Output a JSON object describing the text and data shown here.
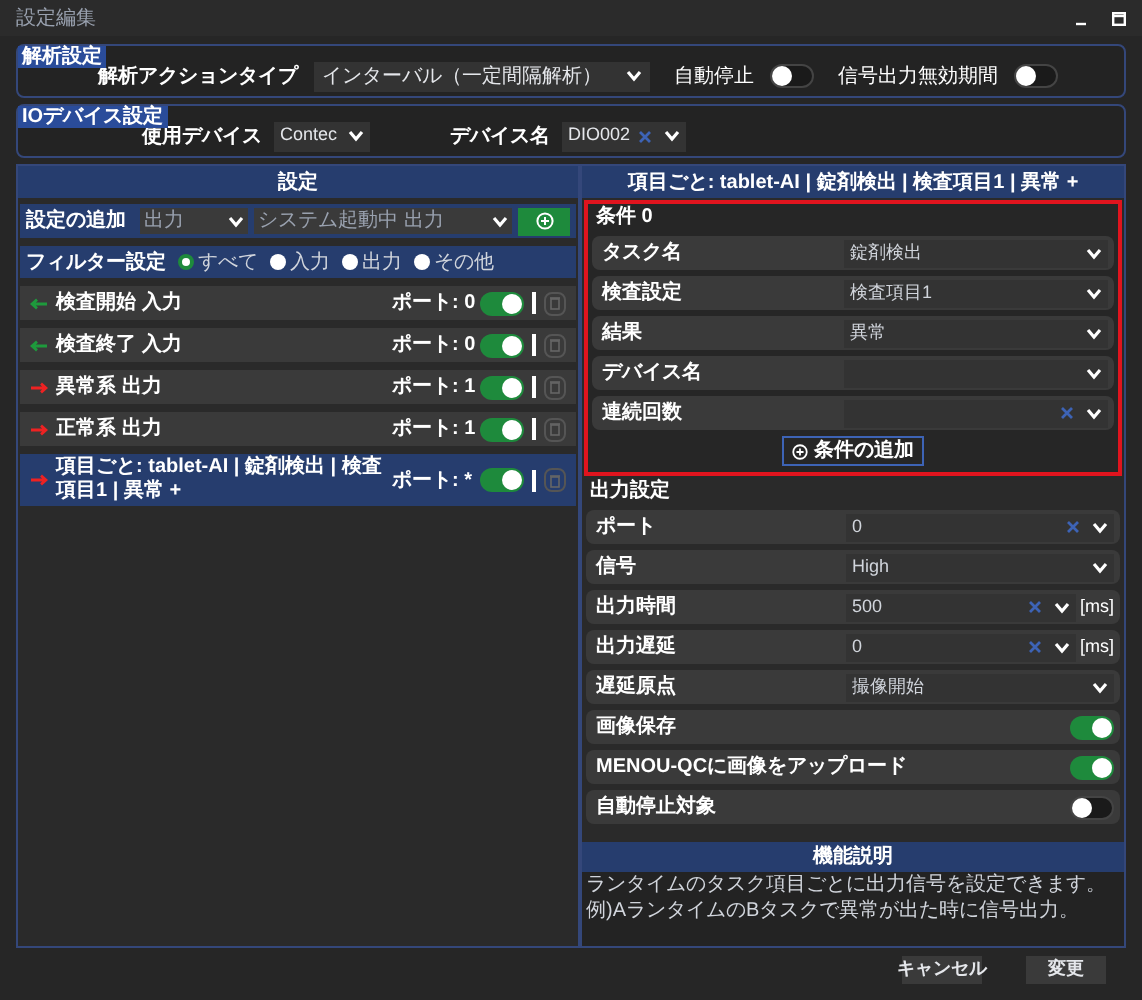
{
  "window": {
    "title": "設定編集"
  },
  "analysis": {
    "section": "解析設定",
    "action_label": "解析アクションタイプ",
    "action_value": "インターバル（一定間隔解析）",
    "toggles": [
      {
        "label": "自動停止",
        "on": false
      },
      {
        "label": "信号出力無効期間",
        "on": false
      }
    ]
  },
  "io_device": {
    "section": "IOデバイス設定",
    "device_label": "使用デバイス",
    "device_value": "Contec",
    "name_label": "デバイス名",
    "name_value": "DIO002",
    "name_clearable": true
  },
  "settings": {
    "title": "設定",
    "add": {
      "label": "設定の追加",
      "type_value": "出力",
      "item_value": "システム起動中 出力"
    },
    "filter": {
      "label": "フィルター設定",
      "options": [
        {
          "label": "すべて",
          "selected": true
        },
        {
          "label": "入力",
          "selected": false
        },
        {
          "label": "出力",
          "selected": false
        },
        {
          "label": "その他",
          "selected": false
        }
      ]
    },
    "items": [
      {
        "kind": "input",
        "label": "検査開始 入力",
        "port": "ポート: 0",
        "enabled": true,
        "selected": false
      },
      {
        "kind": "input",
        "label": "検査終了 入力",
        "port": "ポート: 0",
        "enabled": true,
        "selected": false
      },
      {
        "kind": "output",
        "label": "異常系 出力",
        "port": "ポート: 1",
        "enabled": true,
        "selected": false
      },
      {
        "kind": "output",
        "label": "正常系 出力",
        "port": "ポート: 1",
        "enabled": true,
        "selected": false
      },
      {
        "kind": "output",
        "label": "項目ごと: tablet-AI | 錠剤検出 | 検査項目1 | 異常 +",
        "port": "ポート: *",
        "enabled": true,
        "selected": true
      }
    ]
  },
  "detail": {
    "title": "項目ごと: tablet-AI | 錠剤検出 | 検査項目1 | 異常 +",
    "conditions": {
      "title": "条件 0",
      "fields": [
        {
          "label": "タスク名",
          "value": "錠剤検出",
          "clearable": false
        },
        {
          "label": "検査設定",
          "value": "検査項目1",
          "clearable": false
        },
        {
          "label": "結果",
          "value": "異常",
          "clearable": false
        },
        {
          "label": "デバイス名",
          "clearable": false
        },
        {
          "label": "連続回数",
          "clearable": true
        }
      ],
      "add_button": "条件の追加"
    },
    "output": {
      "title": "出力設定",
      "rows": [
        {
          "kind": "select",
          "label": "ポート",
          "value": "0",
          "clearable": true
        },
        {
          "kind": "select",
          "label": "信号",
          "value": "High",
          "clearable": false
        },
        {
          "kind": "select",
          "label": "出力時間",
          "value": "500",
          "clearable": true,
          "unit": "[ms]"
        },
        {
          "kind": "select",
          "label": "出力遅延",
          "value": "0",
          "clearable": true,
          "unit": "[ms]"
        },
        {
          "kind": "select",
          "label": "遅延原点",
          "value": "撮像開始",
          "clearable": false
        },
        {
          "kind": "toggle",
          "label": "画像保存",
          "on": true
        },
        {
          "kind": "toggle",
          "label": "MENOU-QCに画像をアップロード",
          "on": true
        },
        {
          "kind": "toggle",
          "label": "自動停止対象",
          "on": false
        }
      ]
    },
    "description": {
      "title": "機能説明",
      "lines": [
        "ランタイムのタスク項目ごとに出力信号を設定できます。",
        "例)AランタイムのBタスクで異常が出た時に信号出力。"
      ]
    }
  },
  "buttons": [
    {
      "label": "キャンセル"
    },
    {
      "label": "変更"
    }
  ]
}
